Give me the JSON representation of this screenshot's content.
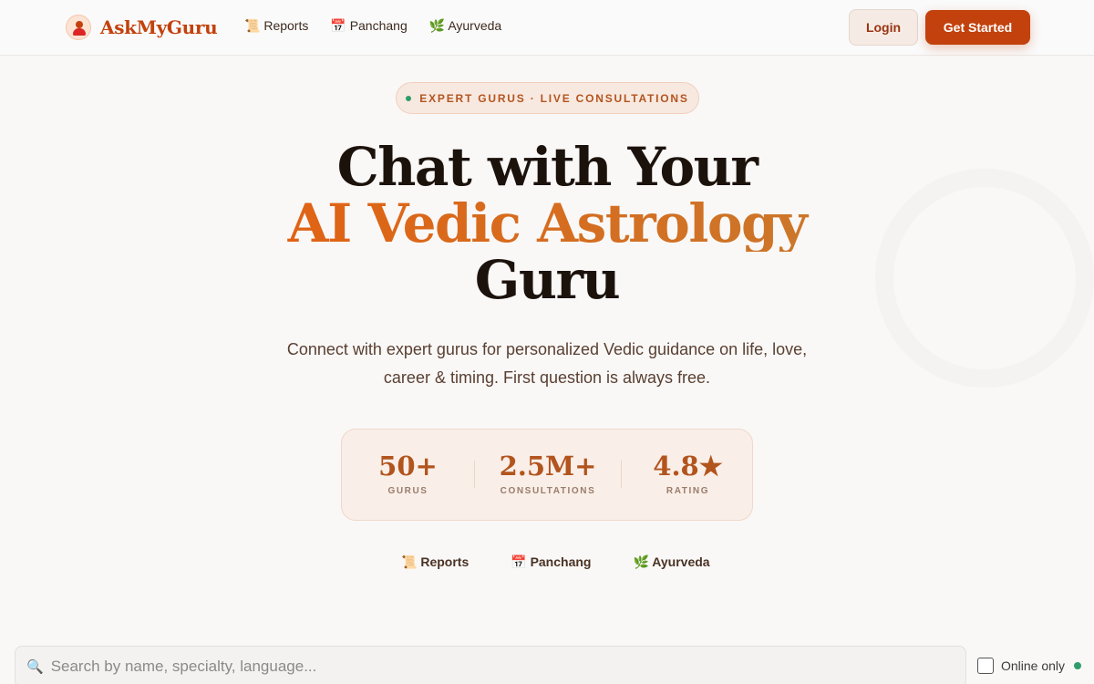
{
  "nav": {
    "brand": "AskMyGuru",
    "links": [
      {
        "icon": "📜",
        "label": "Reports"
      },
      {
        "icon": "📅",
        "label": "Panchang"
      },
      {
        "icon": "🌿",
        "label": "Ayurveda"
      }
    ],
    "login_label": "Login",
    "cta_label": "Get Started"
  },
  "hero": {
    "badge": "EXPERT GURUS · LIVE CONSULTATIONS",
    "title_line1": "Chat with Your",
    "title_line2": "AI Vedic Astrology",
    "title_line3": "Guru",
    "subtitle": "Connect with expert gurus for personalized Vedic guidance on life, love, career & timing. First question is always free."
  },
  "stats": [
    {
      "value": "50+",
      "label": "GURUS"
    },
    {
      "value": "2.5M+",
      "label": "CONSULTATIONS"
    },
    {
      "value": "4.8★",
      "label": "RATING"
    }
  ],
  "quick_links": [
    {
      "icon": "📜",
      "label": "Reports"
    },
    {
      "icon": "📅",
      "label": "Panchang"
    },
    {
      "icon": "🌿",
      "label": "Ayurveda"
    }
  ],
  "search": {
    "placeholder": "Search by name, specialty, language...",
    "value": "",
    "online_label": "Online only",
    "online_checked": false
  },
  "colors": {
    "accent": "#c2410c",
    "brand_text": "#c2410c",
    "online_green": "#2e9d6b"
  }
}
